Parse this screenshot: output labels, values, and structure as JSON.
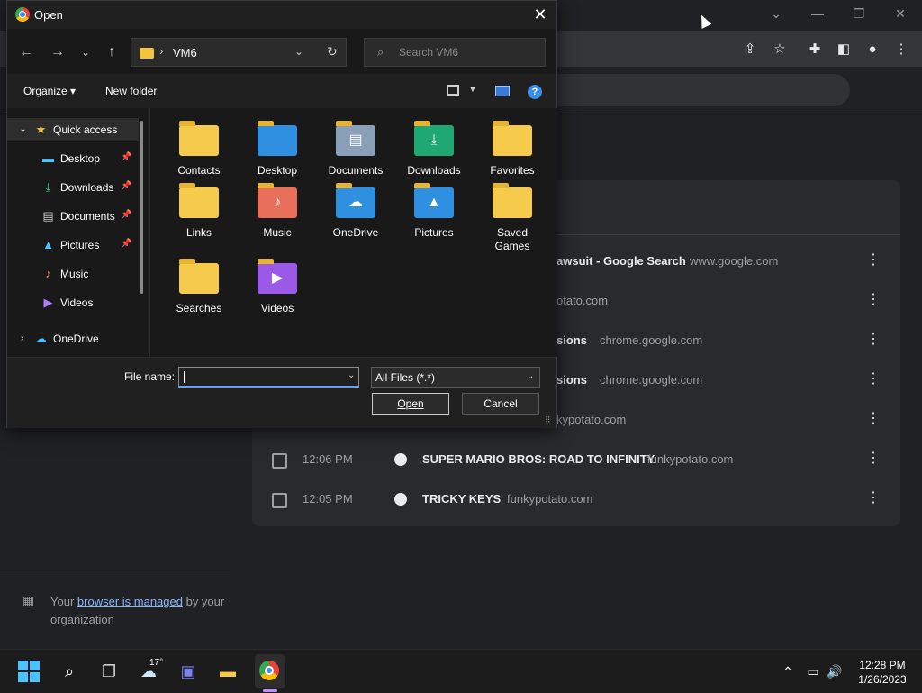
{
  "dialog": {
    "title": "Open",
    "nav": {
      "back_icon": "arrow-left-icon",
      "forward_icon": "arrow-right-icon",
      "recent_icon": "chevron-down-icon",
      "up_icon": "arrow-up-icon",
      "address_sep": "›",
      "address": "VM6",
      "search_placeholder": "Search VM6"
    },
    "toolbar": {
      "organize": "Organize ▾",
      "new_folder": "New folder"
    },
    "nav_pane": {
      "quick_access": "Quick access",
      "items": [
        {
          "label": "Desktop",
          "icon": "desktop-icon",
          "pinned": true
        },
        {
          "label": "Downloads",
          "icon": "download-icon",
          "pinned": true
        },
        {
          "label": "Documents",
          "icon": "documents-icon",
          "pinned": true
        },
        {
          "label": "Pictures",
          "icon": "pictures-icon",
          "pinned": true
        },
        {
          "label": "Music",
          "icon": "music-icon",
          "pinned": false
        },
        {
          "label": "Videos",
          "icon": "videos-icon",
          "pinned": false
        }
      ],
      "onedrive": "OneDrive"
    },
    "folders": [
      {
        "label": "Contacts",
        "icon": "folder-icon"
      },
      {
        "label": "Desktop",
        "icon": "desktop-folder-icon"
      },
      {
        "label": "Documents",
        "icon": "documents-folder-icon"
      },
      {
        "label": "Downloads",
        "icon": "downloads-folder-icon"
      },
      {
        "label": "Favorites",
        "icon": "folder-icon"
      },
      {
        "label": "Links",
        "icon": "folder-icon"
      },
      {
        "label": "Music",
        "icon": "music-folder-icon"
      },
      {
        "label": "OneDrive",
        "icon": "onedrive-folder-icon"
      },
      {
        "label": "Pictures",
        "icon": "pictures-folder-icon"
      },
      {
        "label": "Saved Games",
        "icon": "folder-icon"
      },
      {
        "label": "Searches",
        "icon": "folder-icon"
      },
      {
        "label": "Videos",
        "icon": "videos-folder-icon"
      }
    ],
    "file_name_label": "File name:",
    "file_name_value": "",
    "file_type": "All Files (*.*)",
    "open_label": "Open",
    "cancel_label": "Cancel"
  },
  "history": {
    "rows": [
      {
        "time": "",
        "title": "awsuit - Google Search",
        "domain": "www.google.com"
      },
      {
        "time": "",
        "title": "",
        "domain": "otato.com"
      },
      {
        "time": "",
        "title": "sions",
        "domain": "chrome.google.com"
      },
      {
        "time": "",
        "title": "sions",
        "domain": "chrome.google.com"
      },
      {
        "time": "",
        "title": "",
        "domain": "kypotato.com"
      },
      {
        "time": "12:06 PM",
        "title": "SUPER MARIO BROS: ROAD TO INFINITY",
        "domain": "funkypotato.com"
      },
      {
        "time": "12:05 PM",
        "title": "TRICKY KEYS",
        "domain": "funkypotato.com"
      }
    ]
  },
  "managed": {
    "prefix": "Your",
    "link": "browser is managed",
    "suffix": "by your organization"
  },
  "taskbar": {
    "weather_temp": "17°",
    "time": "12:28 PM",
    "date": "1/26/2023"
  },
  "colors": {
    "accent": "#60a5fa",
    "folder": "#f6cb4b",
    "link": "#8ab4f8"
  }
}
